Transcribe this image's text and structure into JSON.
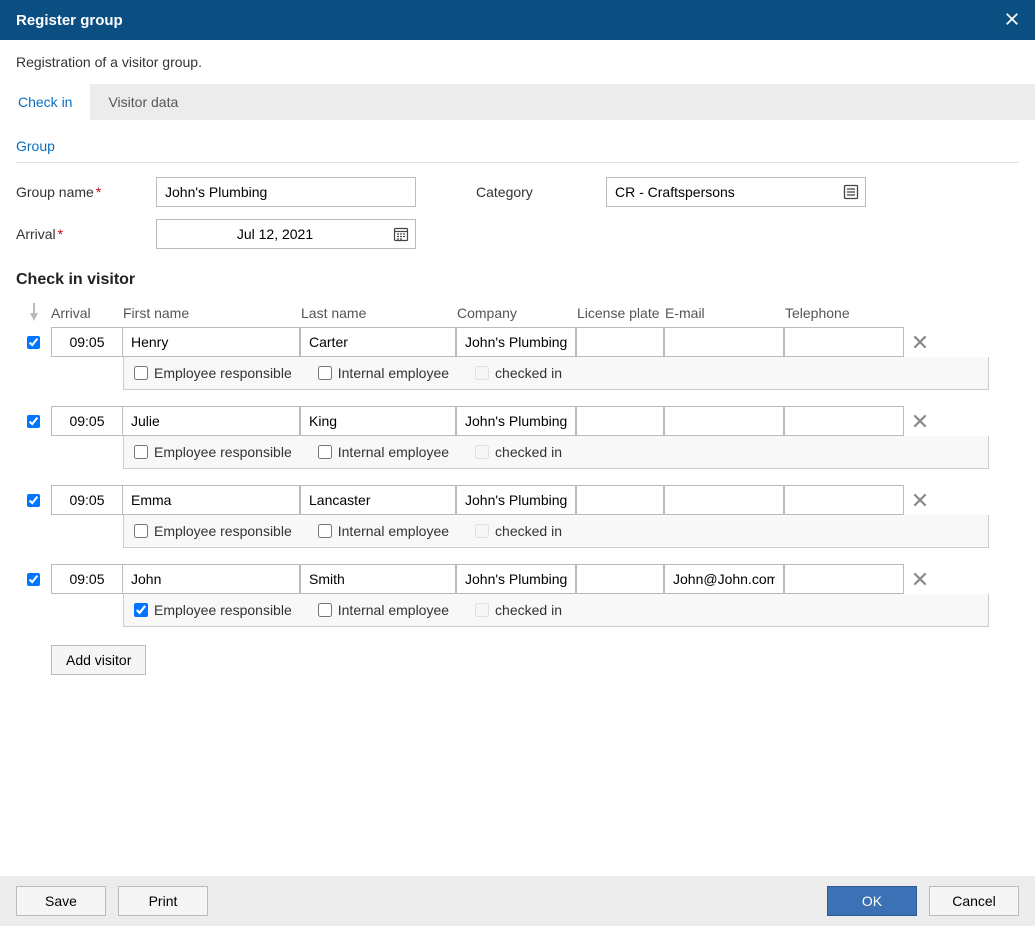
{
  "title": "Register group",
  "subtitle": "Registration of a visitor group.",
  "tabs": {
    "checkin": "Check in",
    "visitordata": "Visitor data"
  },
  "group": {
    "section_label": "Group",
    "name_label": "Group name",
    "name_value": "John's Plumbing",
    "category_label": "Category",
    "category_value": "CR - Craftspersons",
    "arrival_label": "Arrival",
    "arrival_value": "Jul 12, 2021"
  },
  "checkin": {
    "title": "Check in visitor",
    "headers": {
      "arrival": "Arrival",
      "first": "First name",
      "last": "Last name",
      "company": "Company",
      "license": "License plate",
      "email": "E-mail",
      "phone": "Telephone"
    },
    "flags": {
      "emp_resp": "Employee responsible",
      "internal": "Internal employee",
      "checked": "checked in"
    },
    "visitors": [
      {
        "selected": true,
        "arrival": "09:05",
        "first": "Henry",
        "last": "Carter",
        "company": "John's Plumbing",
        "license": "",
        "email": "",
        "phone": "",
        "emp_resp": false,
        "internal": false,
        "checked": false
      },
      {
        "selected": true,
        "arrival": "09:05",
        "first": "Julie",
        "last": "King",
        "company": "John's Plumbing",
        "license": "",
        "email": "",
        "phone": "",
        "emp_resp": false,
        "internal": false,
        "checked": false
      },
      {
        "selected": true,
        "arrival": "09:05",
        "first": "Emma",
        "last": "Lancaster",
        "company": "John's Plumbing",
        "license": "",
        "email": "",
        "phone": "",
        "emp_resp": false,
        "internal": false,
        "checked": false
      },
      {
        "selected": true,
        "arrival": "09:05",
        "first": "John",
        "last": "Smith",
        "company": "John's Plumbing",
        "license": "",
        "email": "John@John.com",
        "phone": "",
        "emp_resp": true,
        "internal": false,
        "checked": false
      }
    ],
    "add_label": "Add visitor"
  },
  "footer": {
    "save": "Save",
    "print": "Print",
    "ok": "OK",
    "cancel": "Cancel"
  }
}
